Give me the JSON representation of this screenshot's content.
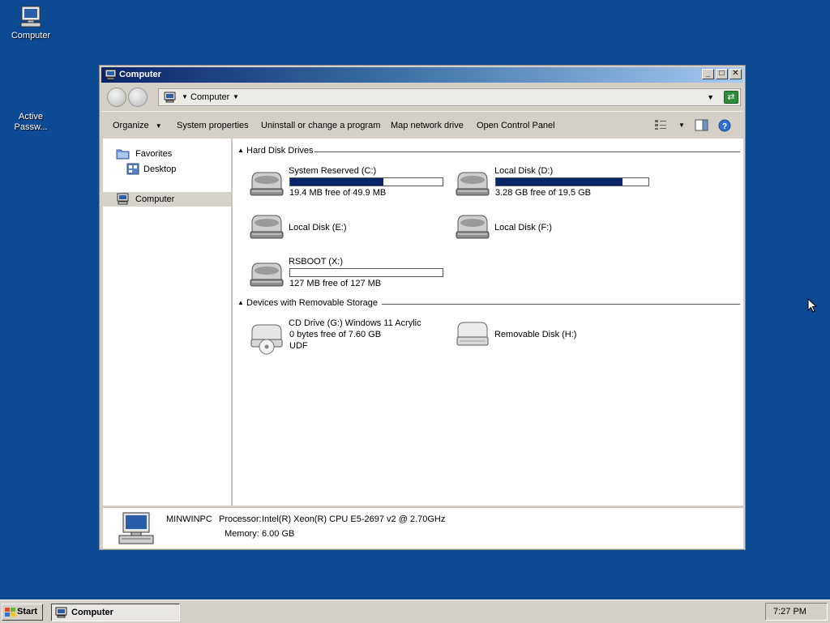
{
  "desktop": {
    "icons": [
      {
        "label": "Computer"
      },
      {
        "label": "Active\nPassw..."
      }
    ]
  },
  "window": {
    "title": "Computer",
    "address": {
      "location": "Computer"
    },
    "toolbar": {
      "organize": "Organize",
      "system_properties": "System properties",
      "uninstall": "Uninstall or change a program",
      "map_drive": "Map network drive",
      "control_panel": "Open Control Panel"
    },
    "nav": {
      "favorites": "Favorites",
      "desktop": "Desktop",
      "computer": "Computer"
    },
    "groups": {
      "hdd": "Hard Disk Drives",
      "removable": "Devices with Removable Storage"
    },
    "drives": [
      {
        "name": "System Reserved (C:)",
        "free_text": "19.4 MB free of 49.9 MB",
        "used_fraction": 0.61
      },
      {
        "name": "Local Disk (D:)",
        "free_text": "3.28 GB free of 19.5 GB",
        "used_fraction": 0.83
      },
      {
        "name": "Local Disk (E:)"
      },
      {
        "name": "Local Disk (F:)"
      },
      {
        "name": "RSBOOT (X:)",
        "free_text": "127 MB free of 127 MB",
        "used_fraction": 0.0
      }
    ],
    "removable": [
      {
        "name": "CD Drive (G:) Windows 11 Acrylic",
        "line2": "0 bytes free of 7.60 GB",
        "line3": "UDF"
      },
      {
        "name": "Removable Disk (H:)"
      }
    ],
    "details": {
      "name": "MINWINPC",
      "processor_label": "Processor:",
      "processor": "Intel(R) Xeon(R) CPU E5-2697 v2 @ 2.70GHz",
      "memory_label": "Memory:",
      "memory": "6.00 GB"
    }
  },
  "taskbar": {
    "start": "Start",
    "task": "Computer",
    "clock": "7:27 PM"
  },
  "colors": {
    "desktop": "#0c4a94",
    "usage_bar": "#0a246a"
  }
}
